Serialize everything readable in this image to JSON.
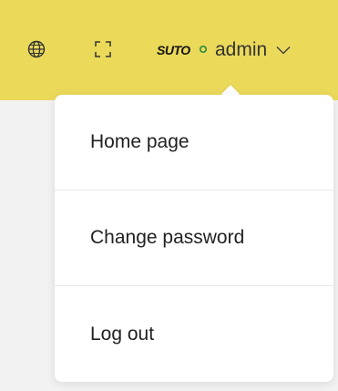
{
  "header": {
    "background_color": "#ebd95a",
    "language_icon": "globe-icon",
    "fullscreen_icon": "fullscreen-icon",
    "user": {
      "logo": "suto",
      "username": "admin",
      "dropdown_icon": "chevron-down-icon"
    }
  },
  "user_menu": {
    "items": [
      {
        "label": "Home page"
      },
      {
        "label": "Change password"
      },
      {
        "label": "Log out"
      }
    ]
  }
}
